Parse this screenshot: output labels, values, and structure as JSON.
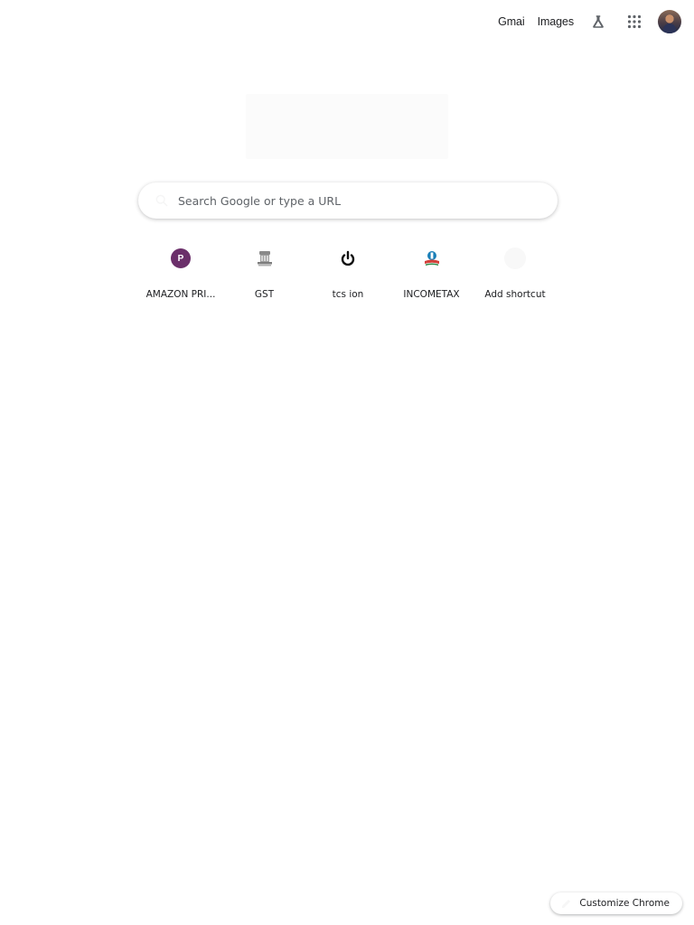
{
  "header": {
    "gmail_label": "Gmai",
    "images_label": "Images",
    "labs_icon": "flask-icon",
    "apps_icon": "apps-grid-icon",
    "account_icon": "avatar"
  },
  "search": {
    "placeholder": "Search Google or type a URL",
    "value": ""
  },
  "shortcuts": [
    {
      "label": "AMAZON PRI...",
      "icon": "amazon-prime-favicon"
    },
    {
      "label": "GST",
      "icon": "gst-emblem-favicon"
    },
    {
      "label": "tcs ion",
      "icon": "tcs-ion-favicon"
    },
    {
      "label": "INCOMETAX",
      "icon": "incometax-favicon"
    },
    {
      "label": "Add shortcut",
      "icon": "add-icon"
    }
  ],
  "favicon_letters": {
    "amazon": "P"
  },
  "footer": {
    "customize_label": "Customize Chrome"
  },
  "colors": {
    "text": "#202124",
    "amazon_badge": "#6b2f6a",
    "background": "#ffffff"
  }
}
